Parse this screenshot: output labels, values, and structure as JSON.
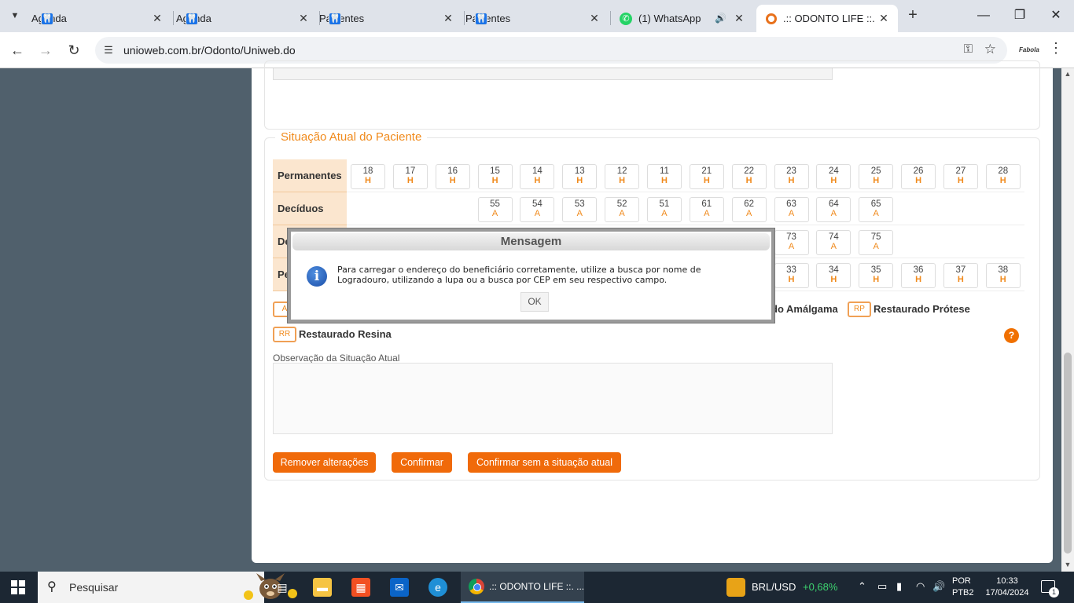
{
  "browser": {
    "tabs": [
      {
        "title": "Agenda",
        "icon": "tooth-icon"
      },
      {
        "title": "Agenda",
        "icon": "tooth-icon"
      },
      {
        "title": "Pacientes",
        "icon": "tooth-icon"
      },
      {
        "title": "Pacientes",
        "icon": "tooth-icon"
      },
      {
        "title": "(1) WhatsApp",
        "icon": "whatsapp-icon"
      },
      {
        "title": ".:: ODONTO LIFE ::.",
        "icon": "odonto-icon",
        "active": true
      }
    ],
    "url": "unioweb.com.br/Odonto/Uniweb.do",
    "profile_label": "Fabola"
  },
  "section": {
    "legend": "Situação Atual do Paciente"
  },
  "odontogram": {
    "rows": [
      {
        "label": "Permanentes",
        "teeth": [
          {
            "num": "18",
            "st": "H"
          },
          {
            "num": "17",
            "st": "H"
          },
          {
            "num": "16",
            "st": "H"
          },
          {
            "num": "15",
            "st": "H"
          },
          {
            "num": "14",
            "st": "H"
          },
          {
            "num": "13",
            "st": "H"
          },
          {
            "num": "12",
            "st": "H"
          },
          {
            "num": "11",
            "st": "H"
          },
          {
            "num": "21",
            "st": "H"
          },
          {
            "num": "22",
            "st": "H"
          },
          {
            "num": "23",
            "st": "H"
          },
          {
            "num": "24",
            "st": "H"
          },
          {
            "num": "25",
            "st": "H"
          },
          {
            "num": "26",
            "st": "H"
          },
          {
            "num": "27",
            "st": "H"
          },
          {
            "num": "28",
            "st": "H"
          }
        ]
      },
      {
        "label": "Decíduos",
        "teeth": [
          {
            "num": "55",
            "st": "A"
          },
          {
            "num": "54",
            "st": "A"
          },
          {
            "num": "53",
            "st": "A"
          },
          {
            "num": "52",
            "st": "A"
          },
          {
            "num": "51",
            "st": "A"
          },
          {
            "num": "61",
            "st": "A"
          },
          {
            "num": "62",
            "st": "A"
          },
          {
            "num": "63",
            "st": "A"
          },
          {
            "num": "64",
            "st": "A"
          },
          {
            "num": "65",
            "st": "A"
          }
        ]
      },
      {
        "label": "De",
        "teeth": [
          {
            "num": "73",
            "st": "A"
          },
          {
            "num": "74",
            "st": "A"
          },
          {
            "num": "75",
            "st": "A"
          }
        ]
      },
      {
        "label": "Pe",
        "teeth": [
          {
            "num": "33",
            "st": "H"
          },
          {
            "num": "34",
            "st": "H"
          },
          {
            "num": "35",
            "st": "H"
          },
          {
            "num": "36",
            "st": "H"
          },
          {
            "num": "37",
            "st": "H"
          },
          {
            "num": "38",
            "st": "H"
          }
        ]
      }
    ],
    "legend_items": [
      {
        "code": "A",
        "label": ""
      },
      {
        "code": "",
        "label": "do Amálgama"
      },
      {
        "code": "RP",
        "label": "Restaurado Prótese"
      },
      {
        "code": "RR",
        "label": "Restaurado Resina"
      }
    ]
  },
  "observation": {
    "label": "Observação da Situação Atual",
    "value": ""
  },
  "buttons": {
    "remove": "Remover alterações",
    "confirm": "Confirmar",
    "confirm_without": "Confirmar sem a situação atual"
  },
  "help_label": "?",
  "modal": {
    "title": "Mensagem",
    "message_line1": "Para carregar o endereço do beneficiário corretamente, utilize a busca por nome de",
    "message_line2": "Logradouro, utilizando a lupa ou a busca por CEP em seu respectivo campo.",
    "ok": "OK",
    "icon": "info-icon"
  },
  "taskbar": {
    "search_placeholder": "Pesquisar",
    "active_app": ".:: ODONTO LIFE ::. ...",
    "currency": "BRL/USD",
    "currency_change": "+0,68%",
    "lang_line1": "POR",
    "lang_line2": "PTB2",
    "time": "10:33",
    "date": "17/04/2024",
    "notifications": "1"
  },
  "colors": {
    "accent": "#f06a0a",
    "legend_orange": "#f08a1c",
    "page_bg": "#50606c"
  }
}
